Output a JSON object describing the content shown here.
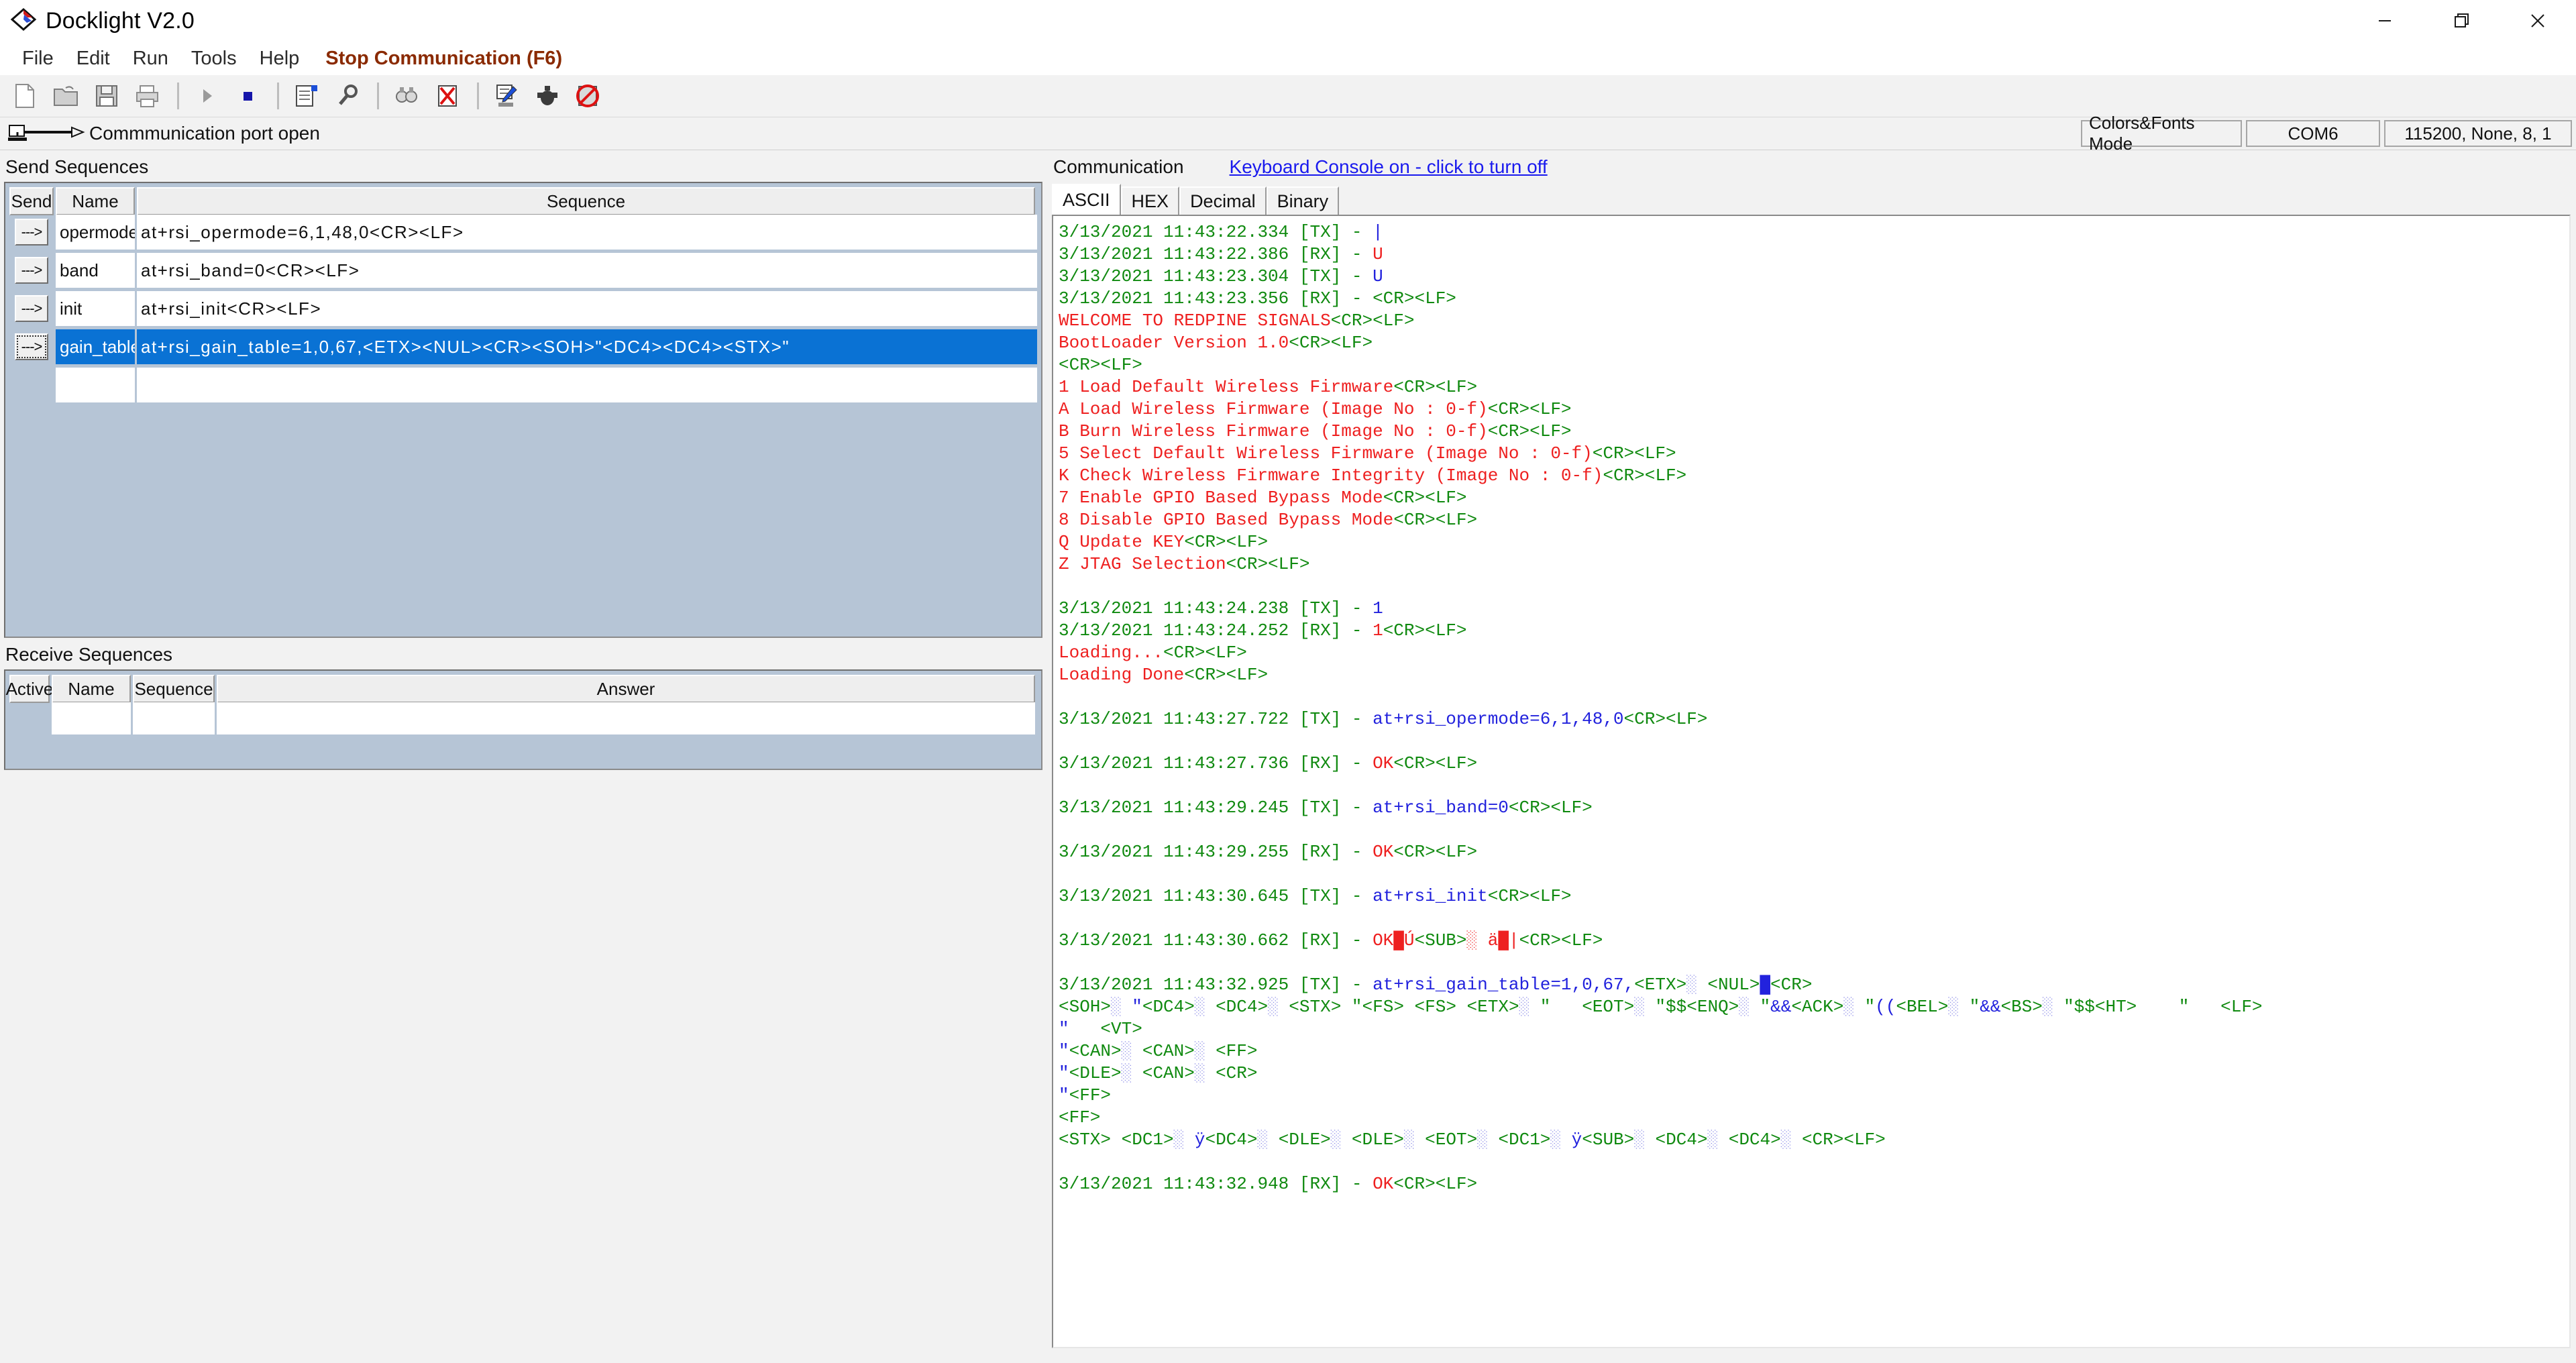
{
  "window": {
    "title": "Docklight V2.0",
    "logo_icon": "docklight-logo-icon",
    "controls": [
      {
        "name": "minimize-button",
        "glyph": "minimize-icon"
      },
      {
        "name": "maximize-button",
        "glyph": "restore-icon"
      },
      {
        "name": "close-button",
        "glyph": "close-icon"
      }
    ]
  },
  "menubar": {
    "items": [
      {
        "label": "File",
        "name": "menu-file"
      },
      {
        "label": "Edit",
        "name": "menu-edit"
      },
      {
        "label": "Run",
        "name": "menu-run"
      },
      {
        "label": "Tools",
        "name": "menu-tools"
      },
      {
        "label": "Help",
        "name": "menu-help"
      }
    ],
    "accent_item": {
      "label": "Stop Communication (F6)",
      "name": "menu-stop-communication",
      "color": "#8a2a00"
    }
  },
  "toolbar": {
    "buttons": [
      {
        "name": "new-file-icon"
      },
      {
        "name": "open-folder-icon"
      },
      {
        "name": "save-icon"
      },
      {
        "name": "print-icon"
      },
      {
        "name": "start-communication-icon"
      },
      {
        "name": "stop-communication-icon"
      },
      {
        "name": "edit-send-sequence-icon"
      },
      {
        "name": "project-settings-icon"
      },
      {
        "name": "find-icon"
      },
      {
        "name": "clear-communication-icon"
      },
      {
        "name": "edit-keyboard-console-icon"
      },
      {
        "name": "flow-control-icon"
      },
      {
        "name": "disable-logging-icon"
      }
    ]
  },
  "statusbar": {
    "port_icon": "serial-port-icon",
    "status_text": "Commmunication port open",
    "fields": [
      {
        "label": "Colors&Fonts Mode",
        "name": "status-colors-fonts-mode"
      },
      {
        "label": "COM6",
        "name": "status-com-port"
      },
      {
        "label": "115200, None, 8, 1",
        "name": "status-port-settings"
      }
    ]
  },
  "send_sequences": {
    "label": "Send Sequences",
    "columns": [
      "Send",
      "Name",
      "Sequence"
    ],
    "rows": [
      {
        "send": "--->",
        "name": "opermode",
        "sequence": "at+rsi_opermode=6,1,48,0<CR><LF>",
        "selected": false
      },
      {
        "send": "--->",
        "name": "band",
        "sequence": "at+rsi_band=0<CR><LF>",
        "selected": false
      },
      {
        "send": "--->",
        "name": "init",
        "sequence": "at+rsi_init<CR><LF>",
        "selected": false
      },
      {
        "send": "--->",
        "name": "gain_table",
        "sequence": "at+rsi_gain_table=1,0,67,<ETX><NUL><CR><SOH>\"<DC4><DC4><STX>\"",
        "selected": true
      },
      {
        "send": "",
        "name": "",
        "sequence": "",
        "selected": false
      }
    ]
  },
  "receive_sequences": {
    "label": "Receive Sequences",
    "columns": [
      "Active",
      "Name",
      "Sequence",
      "Answer"
    ],
    "rows": [
      {
        "active": "",
        "name": "",
        "sequence": "",
        "answer": ""
      }
    ]
  },
  "communication": {
    "label": "Communication",
    "keyboard_console_link": "Keyboard Console on - click to turn off",
    "tabs": [
      {
        "label": "ASCII",
        "name": "tab-ascii",
        "active": true
      },
      {
        "label": "HEX",
        "name": "tab-hex",
        "active": false
      },
      {
        "label": "Decimal",
        "name": "tab-decimal",
        "active": false
      },
      {
        "label": "Binary",
        "name": "tab-binary",
        "active": false
      }
    ],
    "log_lines": [
      [
        {
          "t": "3/13/2021 11:43:22.334 [TX] - ",
          "c": "g"
        },
        {
          "t": "|",
          "c": "b"
        }
      ],
      [
        {
          "t": "3/13/2021 11:43:22.386 [RX] - ",
          "c": "g"
        },
        {
          "t": "U",
          "c": "r"
        }
      ],
      [
        {
          "t": "3/13/2021 11:43:23.304 [TX] - ",
          "c": "g"
        },
        {
          "t": "U",
          "c": "b"
        }
      ],
      [
        {
          "t": "3/13/2021 11:43:23.356 [RX] - <CR><LF>",
          "c": "g"
        }
      ],
      [
        {
          "t": "WELCOME TO REDPINE SIGNALS",
          "c": "r"
        },
        {
          "t": "<CR><LF>",
          "c": "g"
        }
      ],
      [
        {
          "t": "BootLoader Version 1.0",
          "c": "r"
        },
        {
          "t": "<CR><LF>",
          "c": "g"
        }
      ],
      [
        {
          "t": "<CR><LF>",
          "c": "g"
        }
      ],
      [
        {
          "t": "1 Load Default Wireless Firmware",
          "c": "r"
        },
        {
          "t": "<CR><LF>",
          "c": "g"
        }
      ],
      [
        {
          "t": "A Load Wireless Firmware (Image No : 0-f)",
          "c": "r"
        },
        {
          "t": "<CR><LF>",
          "c": "g"
        }
      ],
      [
        {
          "t": "B Burn Wireless Firmware (Image No : 0-f)",
          "c": "r"
        },
        {
          "t": "<CR><LF>",
          "c": "g"
        }
      ],
      [
        {
          "t": "5 Select Default Wireless Firmware (Image No : 0-f)",
          "c": "r"
        },
        {
          "t": "<CR><LF>",
          "c": "g"
        }
      ],
      [
        {
          "t": "K Check Wireless Firmware Integrity (Image No : 0-f)",
          "c": "r"
        },
        {
          "t": "<CR><LF>",
          "c": "g"
        }
      ],
      [
        {
          "t": "7 Enable GPIO Based Bypass Mode",
          "c": "r"
        },
        {
          "t": "<CR><LF>",
          "c": "g"
        }
      ],
      [
        {
          "t": "8 Disable GPIO Based Bypass Mode",
          "c": "r"
        },
        {
          "t": "<CR><LF>",
          "c": "g"
        }
      ],
      [
        {
          "t": "Q Update KEY",
          "c": "r"
        },
        {
          "t": "<CR><LF>",
          "c": "g"
        }
      ],
      [
        {
          "t": "Z JTAG Selection",
          "c": "r"
        },
        {
          "t": "<CR><LF>",
          "c": "g"
        }
      ],
      [
        {
          "t": "",
          "c": "g"
        }
      ],
      [
        {
          "t": "3/13/2021 11:43:24.238 [TX] - ",
          "c": "g"
        },
        {
          "t": "1",
          "c": "b"
        }
      ],
      [
        {
          "t": "3/13/2021 11:43:24.252 [RX] - ",
          "c": "g"
        },
        {
          "t": "1",
          "c": "r"
        },
        {
          "t": "<CR><LF>",
          "c": "g"
        }
      ],
      [
        {
          "t": "Loading...",
          "c": "r"
        },
        {
          "t": "<CR><LF>",
          "c": "g"
        }
      ],
      [
        {
          "t": "Loading Done",
          "c": "r"
        },
        {
          "t": "<CR><LF>",
          "c": "g"
        }
      ],
      [
        {
          "t": "",
          "c": "g"
        }
      ],
      [
        {
          "t": "3/13/2021 11:43:27.722 [TX] - ",
          "c": "g"
        },
        {
          "t": "at+rsi_opermode=6,1,48,0",
          "c": "b"
        },
        {
          "t": "<CR><LF>",
          "c": "g"
        }
      ],
      [
        {
          "t": "",
          "c": "g"
        }
      ],
      [
        {
          "t": "3/13/2021 11:43:27.736 [RX] - ",
          "c": "g"
        },
        {
          "t": "OK",
          "c": "r"
        },
        {
          "t": "<CR><LF>",
          "c": "g"
        }
      ],
      [
        {
          "t": "",
          "c": "g"
        }
      ],
      [
        {
          "t": "3/13/2021 11:43:29.245 [TX] - ",
          "c": "g"
        },
        {
          "t": "at+rsi_band=0",
          "c": "b"
        },
        {
          "t": "<CR><LF>",
          "c": "g"
        }
      ],
      [
        {
          "t": "",
          "c": "g"
        }
      ],
      [
        {
          "t": "3/13/2021 11:43:29.255 [RX] - ",
          "c": "g"
        },
        {
          "t": "OK",
          "c": "r"
        },
        {
          "t": "<CR><LF>",
          "c": "g"
        }
      ],
      [
        {
          "t": "",
          "c": "g"
        }
      ],
      [
        {
          "t": "3/13/2021 11:43:30.645 [TX] - ",
          "c": "g"
        },
        {
          "t": "at+rsi_init",
          "c": "b"
        },
        {
          "t": "<CR><LF>",
          "c": "g"
        }
      ],
      [
        {
          "t": "",
          "c": "g"
        }
      ],
      [
        {
          "t": "3/13/2021 11:43:30.662 [RX] - ",
          "c": "g"
        },
        {
          "t": "OK█Ú",
          "c": "r"
        },
        {
          "t": "<SUB>",
          "c": "g"
        },
        {
          "t": "░ ä█|",
          "c": "r"
        },
        {
          "t": "<CR><LF>",
          "c": "g"
        }
      ],
      [
        {
          "t": "",
          "c": "g"
        }
      ],
      [
        {
          "t": "3/13/2021 11:43:32.925 [TX] - ",
          "c": "g"
        },
        {
          "t": "at+rsi_gain_table=1,0,67,",
          "c": "b"
        },
        {
          "t": "<ETX>",
          "c": "g"
        },
        {
          "t": "░",
          "c": "bx"
        },
        {
          "t": " <NUL>",
          "c": "g"
        },
        {
          "t": "█",
          "c": "b"
        },
        {
          "t": "<CR>",
          "c": "g"
        }
      ],
      [
        {
          "t": "<SOH>",
          "c": "g"
        },
        {
          "t": "░",
          "c": "bx"
        },
        {
          "t": " \"",
          "c": "b"
        },
        {
          "t": "<DC4>",
          "c": "g"
        },
        {
          "t": "░",
          "c": "bx"
        },
        {
          "t": " <DC4>",
          "c": "g"
        },
        {
          "t": "░",
          "c": "bx"
        },
        {
          "t": " <STX> \"",
          "c": "g"
        },
        {
          "t": "<FS> <FS> <ETX>",
          "c": "g"
        },
        {
          "t": "░",
          "c": "bx"
        },
        {
          "t": " \"   <EOT>",
          "c": "g"
        },
        {
          "t": "░",
          "c": "bx"
        },
        {
          "t": " \"$$<ENQ>",
          "c": "g"
        },
        {
          "t": "░",
          "c": "bx"
        },
        {
          "t": " \"",
          "c": "g"
        },
        {
          "t": "&&",
          "c": "b"
        },
        {
          "t": "<ACK>",
          "c": "g"
        },
        {
          "t": "░",
          "c": "bx"
        },
        {
          "t": " \"",
          "c": "g"
        },
        {
          "t": "((",
          "c": "b"
        },
        {
          "t": "<BEL>",
          "c": "g"
        },
        {
          "t": "░",
          "c": "bx"
        },
        {
          "t": " \"",
          "c": "g"
        },
        {
          "t": "&&",
          "c": "b"
        },
        {
          "t": "<BS>",
          "c": "g"
        },
        {
          "t": "░",
          "c": "bx"
        },
        {
          "t": " \"$$<HT>    \"   <LF>",
          "c": "g"
        }
      ],
      [
        {
          "t": "\"",
          "c": "b"
        },
        {
          "t": "   <VT>",
          "c": "g"
        }
      ],
      [
        {
          "t": "\"",
          "c": "b"
        },
        {
          "t": "<CAN>",
          "c": "g"
        },
        {
          "t": "░",
          "c": "bx"
        },
        {
          "t": " <CAN>",
          "c": "g"
        },
        {
          "t": "░",
          "c": "bx"
        },
        {
          "t": " <FF>",
          "c": "g"
        }
      ],
      [
        {
          "t": "\"",
          "c": "b"
        },
        {
          "t": "<DLE>",
          "c": "g"
        },
        {
          "t": "░",
          "c": "bx"
        },
        {
          "t": " <CAN>",
          "c": "g"
        },
        {
          "t": "░",
          "c": "bx"
        },
        {
          "t": " <CR>",
          "c": "g"
        }
      ],
      [
        {
          "t": "\"",
          "c": "b"
        },
        {
          "t": "<FF>",
          "c": "g"
        }
      ],
      [
        {
          "t": "<FF>",
          "c": "g"
        }
      ],
      [
        {
          "t": "<STX> <DC1>",
          "c": "g"
        },
        {
          "t": "░",
          "c": "bx"
        },
        {
          "t": " ",
          "c": "g"
        },
        {
          "t": "ÿ",
          "c": "b"
        },
        {
          "t": "<DC4>",
          "c": "g"
        },
        {
          "t": "░",
          "c": "bx"
        },
        {
          "t": " <DLE>",
          "c": "g"
        },
        {
          "t": "░",
          "c": "bx"
        },
        {
          "t": " <DLE>",
          "c": "g"
        },
        {
          "t": "░",
          "c": "bx"
        },
        {
          "t": " <EOT>",
          "c": "g"
        },
        {
          "t": "░",
          "c": "bx"
        },
        {
          "t": " <DC1>",
          "c": "g"
        },
        {
          "t": "░",
          "c": "bx"
        },
        {
          "t": " ",
          "c": "g"
        },
        {
          "t": "ÿ",
          "c": "b"
        },
        {
          "t": "<SUB>",
          "c": "g"
        },
        {
          "t": "░",
          "c": "bx"
        },
        {
          "t": " <DC4>",
          "c": "g"
        },
        {
          "t": "░",
          "c": "bx"
        },
        {
          "t": " <DC4>",
          "c": "g"
        },
        {
          "t": "░",
          "c": "bx"
        },
        {
          "t": " <CR><LF>",
          "c": "g"
        }
      ],
      [
        {
          "t": "",
          "c": "g"
        }
      ],
      [
        {
          "t": "3/13/2021 11:43:32.948 [RX] - ",
          "c": "g"
        },
        {
          "t": "OK",
          "c": "r"
        },
        {
          "t": "<CR><LF>",
          "c": "g"
        }
      ]
    ]
  }
}
